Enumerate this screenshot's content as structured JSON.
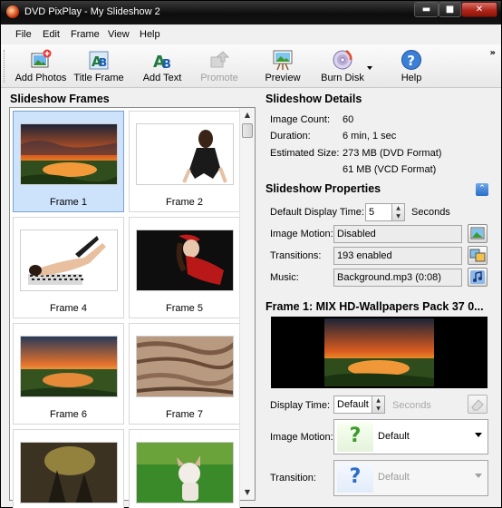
{
  "window": {
    "title": "DVD PixPlay - My Slideshow 2",
    "buttons": {
      "minimize": "▬",
      "maximize": "■",
      "close": "✕"
    }
  },
  "menu": [
    "File",
    "Edit",
    "Frame",
    "View",
    "Help"
  ],
  "toolbar": {
    "add_photos": "Add Photos",
    "title_frame": "Title Frame",
    "add_text": "Add Text",
    "promote": "Promote",
    "preview": "Preview",
    "burn_disk": "Burn Disk",
    "help": "Help",
    "overflow": "»"
  },
  "frames_panel": {
    "heading": "Slideshow Frames",
    "frames": [
      {
        "label": "Frame 1",
        "selected": true
      },
      {
        "label": "Frame 2",
        "selected": false
      },
      {
        "label": "Frame 4",
        "selected": false
      },
      {
        "label": "Frame 5",
        "selected": false
      },
      {
        "label": "Frame 6",
        "selected": false
      },
      {
        "label": "Frame 7",
        "selected": false
      },
      {
        "label": "",
        "selected": false
      },
      {
        "label": "",
        "selected": false
      }
    ]
  },
  "details": {
    "heading": "Slideshow Details",
    "image_count_label": "Image Count:",
    "image_count": "60",
    "duration_label": "Duration:",
    "duration": "6 min, 1 sec",
    "size_label": "Estimated Size:",
    "size_dvd": "273 MB (DVD Format)",
    "size_vcd": "61 MB (VCD Format)"
  },
  "properties": {
    "heading": "Slideshow Properties",
    "display_time_label": "Default Display Time:",
    "display_time": "5",
    "seconds": "Seconds",
    "motion_label": "Image Motion:",
    "motion": "Disabled",
    "transitions_label": "Transitions:",
    "transitions": "193 enabled",
    "music_label": "Music:",
    "music": "Background.mp3 (0:08)"
  },
  "frame_section": {
    "heading": "Frame 1: MIX HD-Wallpapers Pack 37 0...",
    "display_time_label": "Display Time:",
    "display_time": "Default",
    "seconds": "Seconds",
    "motion_label": "Image Motion:",
    "motion": "Default",
    "transition_label": "Transition:",
    "transition": "Default",
    "question_mark": "?"
  },
  "colors": {
    "accent": "#2a6dc8",
    "selection": "#cde2fb",
    "title_bar": "#0d0d0d"
  }
}
